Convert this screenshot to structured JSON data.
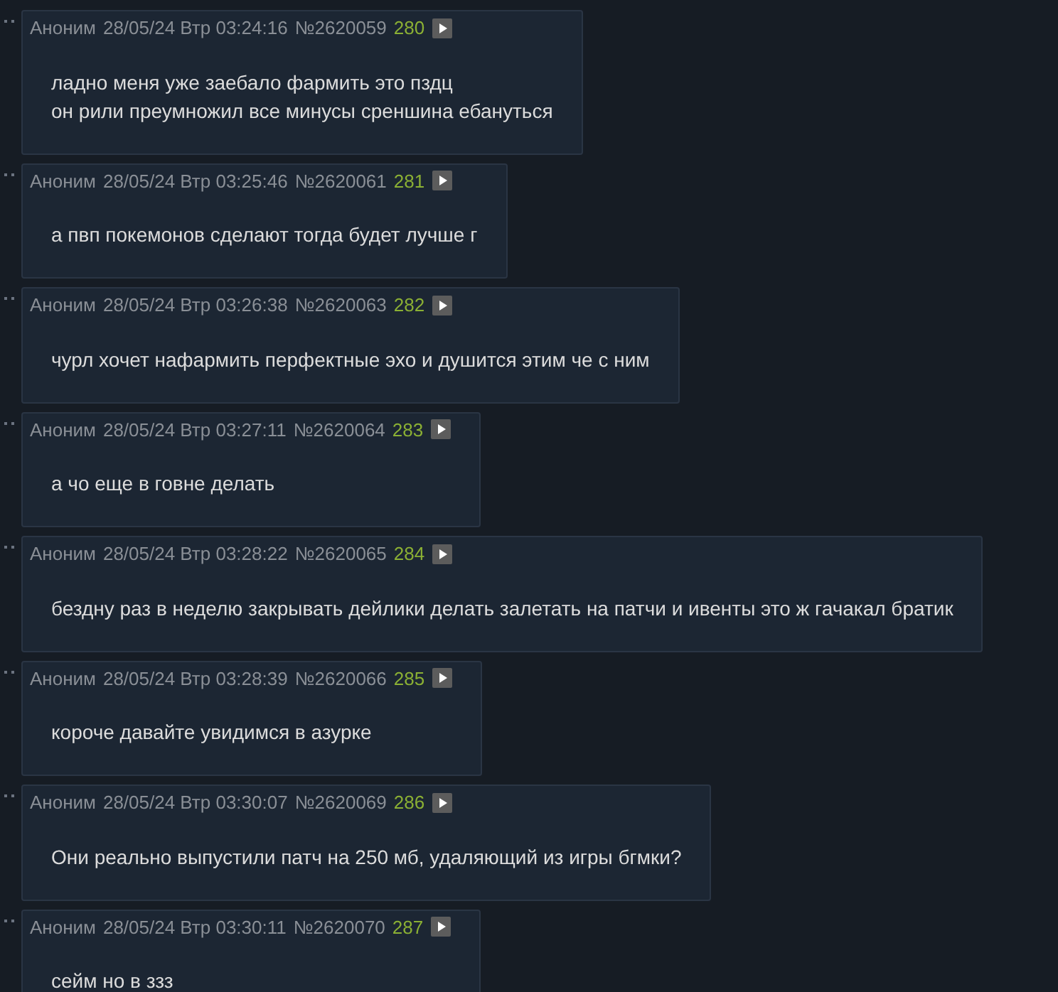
{
  "posts": [
    {
      "author": "Аноним",
      "date": "28/05/24 Втр 03:24:16",
      "number": "№2620059",
      "reply_index": "280",
      "lines": [
        "ладно меня уже заебало фармить это пздц",
        "он рили преумножил все минусы среншина ебануться"
      ]
    },
    {
      "author": "Аноним",
      "date": "28/05/24 Втр 03:25:46",
      "number": "№2620061",
      "reply_index": "281",
      "lines": [
        "а пвп покемонов сделают тогда будет лучше г"
      ]
    },
    {
      "author": "Аноним",
      "date": "28/05/24 Втр 03:26:38",
      "number": "№2620063",
      "reply_index": "282",
      "lines": [
        "чурл хочет нафармить перфектные эхо и душится этим че с ним"
      ]
    },
    {
      "author": "Аноним",
      "date": "28/05/24 Втр 03:27:11",
      "number": "№2620064",
      "reply_index": "283",
      "lines": [
        "а чо еще в говне делать"
      ]
    },
    {
      "author": "Аноним",
      "date": "28/05/24 Втр 03:28:22",
      "number": "№2620065",
      "reply_index": "284",
      "lines": [
        "бездну раз в неделю закрывать дейлики делать залетать на патчи и ивенты это ж гачакал братик"
      ]
    },
    {
      "author": "Аноним",
      "date": "28/05/24 Втр 03:28:39",
      "number": "№2620066",
      "reply_index": "285",
      "lines": [
        "короче давайте увидимся в азурке"
      ]
    },
    {
      "author": "Аноним",
      "date": "28/05/24 Втр 03:30:07",
      "number": "№2620069",
      "reply_index": "286",
      "lines": [
        "Они реально выпустили патч на 250 мб, удаляющий из игры бгмки?"
      ]
    },
    {
      "author": "Аноним",
      "date": "28/05/24 Втр 03:30:11",
      "number": "№2620070",
      "reply_index": "287",
      "lines": [
        "сейм но в ззз"
      ]
    }
  ]
}
